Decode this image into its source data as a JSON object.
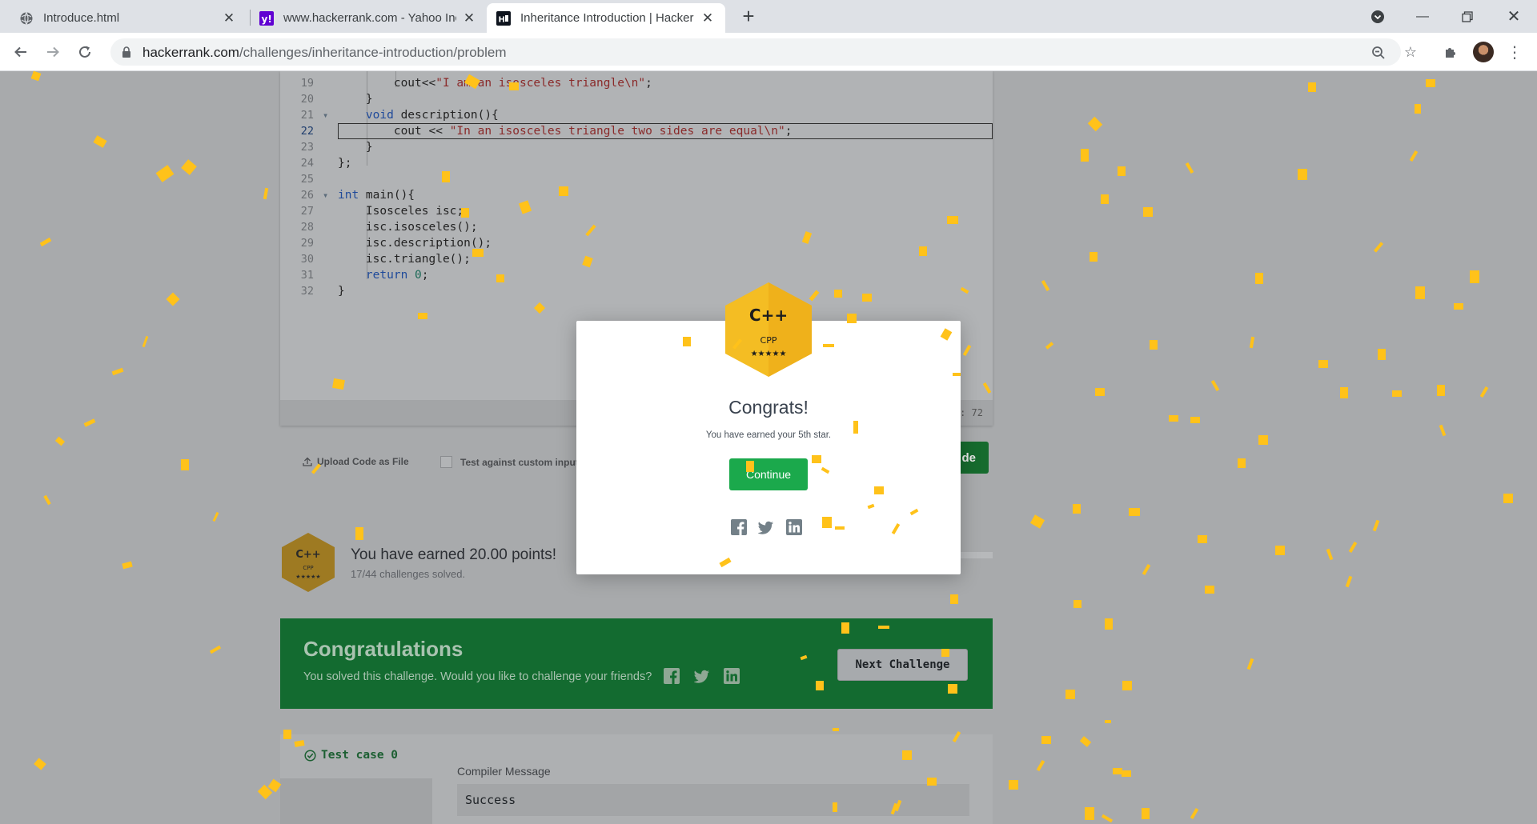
{
  "browser": {
    "tabs": [
      {
        "title": "Introduce.html",
        "icon": "globe-icon",
        "active": false
      },
      {
        "title": "www.hackerrank.com - Yahoo Inc",
        "icon": "yahoo-icon",
        "active": false
      },
      {
        "title": "Inheritance Introduction | Hacker",
        "icon": "hackerrank-icon",
        "active": true
      }
    ],
    "url_host": "hackerrank.com",
    "url_path": "/challenges/inheritance-introduction/problem"
  },
  "editor": {
    "lines": [
      {
        "n": "19",
        "text": "        cout<<\"I am an isosceles triangle\\n\";"
      },
      {
        "n": "20",
        "text": "    }"
      },
      {
        "n": "21",
        "text": "    void description(){"
      },
      {
        "n": "22",
        "text": "        cout << \"In an isosceles triangle two sides are equal\\n\";"
      },
      {
        "n": "23",
        "text": "    }"
      },
      {
        "n": "24",
        "text": "};"
      },
      {
        "n": "25",
        "text": ""
      },
      {
        "n": "26",
        "text": "int main(){"
      },
      {
        "n": "27",
        "text": "    Isosceles isc;"
      },
      {
        "n": "28",
        "text": "    isc.isosceles();"
      },
      {
        "n": "29",
        "text": "    isc.description();"
      },
      {
        "n": "30",
        "text": "    isc.triangle();"
      },
      {
        "n": "31",
        "text": "    return 0;"
      },
      {
        "n": "32",
        "text": "}"
      }
    ],
    "status_pos": ": 72"
  },
  "actions": {
    "upload_label": "Upload Code as File",
    "custom_input_label": "Test against custom input",
    "submit_label": "de"
  },
  "points": {
    "badge_lang": "C++",
    "badge_name": "CPP",
    "title": "You have earned 20.00 points!",
    "sub": "17/44 challenges solved."
  },
  "congrats": {
    "title": "Congratulations",
    "sub": "You solved this challenge. Would you like to challenge your friends?",
    "next_label": "Next Challenge"
  },
  "results": {
    "test_case": "Test case 0",
    "compiler_label": "Compiler Message",
    "compiler_value": "Success"
  },
  "modal": {
    "badge_lang": "C++",
    "badge_name": "CPP",
    "badge_stars": "★★★★★",
    "heading": "Congrats!",
    "message": "You have earned your 5th star.",
    "continue_label": "Continue"
  },
  "colors": {
    "accent_green": "#1ba94c",
    "banner_green": "#136b30",
    "confetti": "#ffc21a",
    "badge_gold": "#f4bd23"
  }
}
